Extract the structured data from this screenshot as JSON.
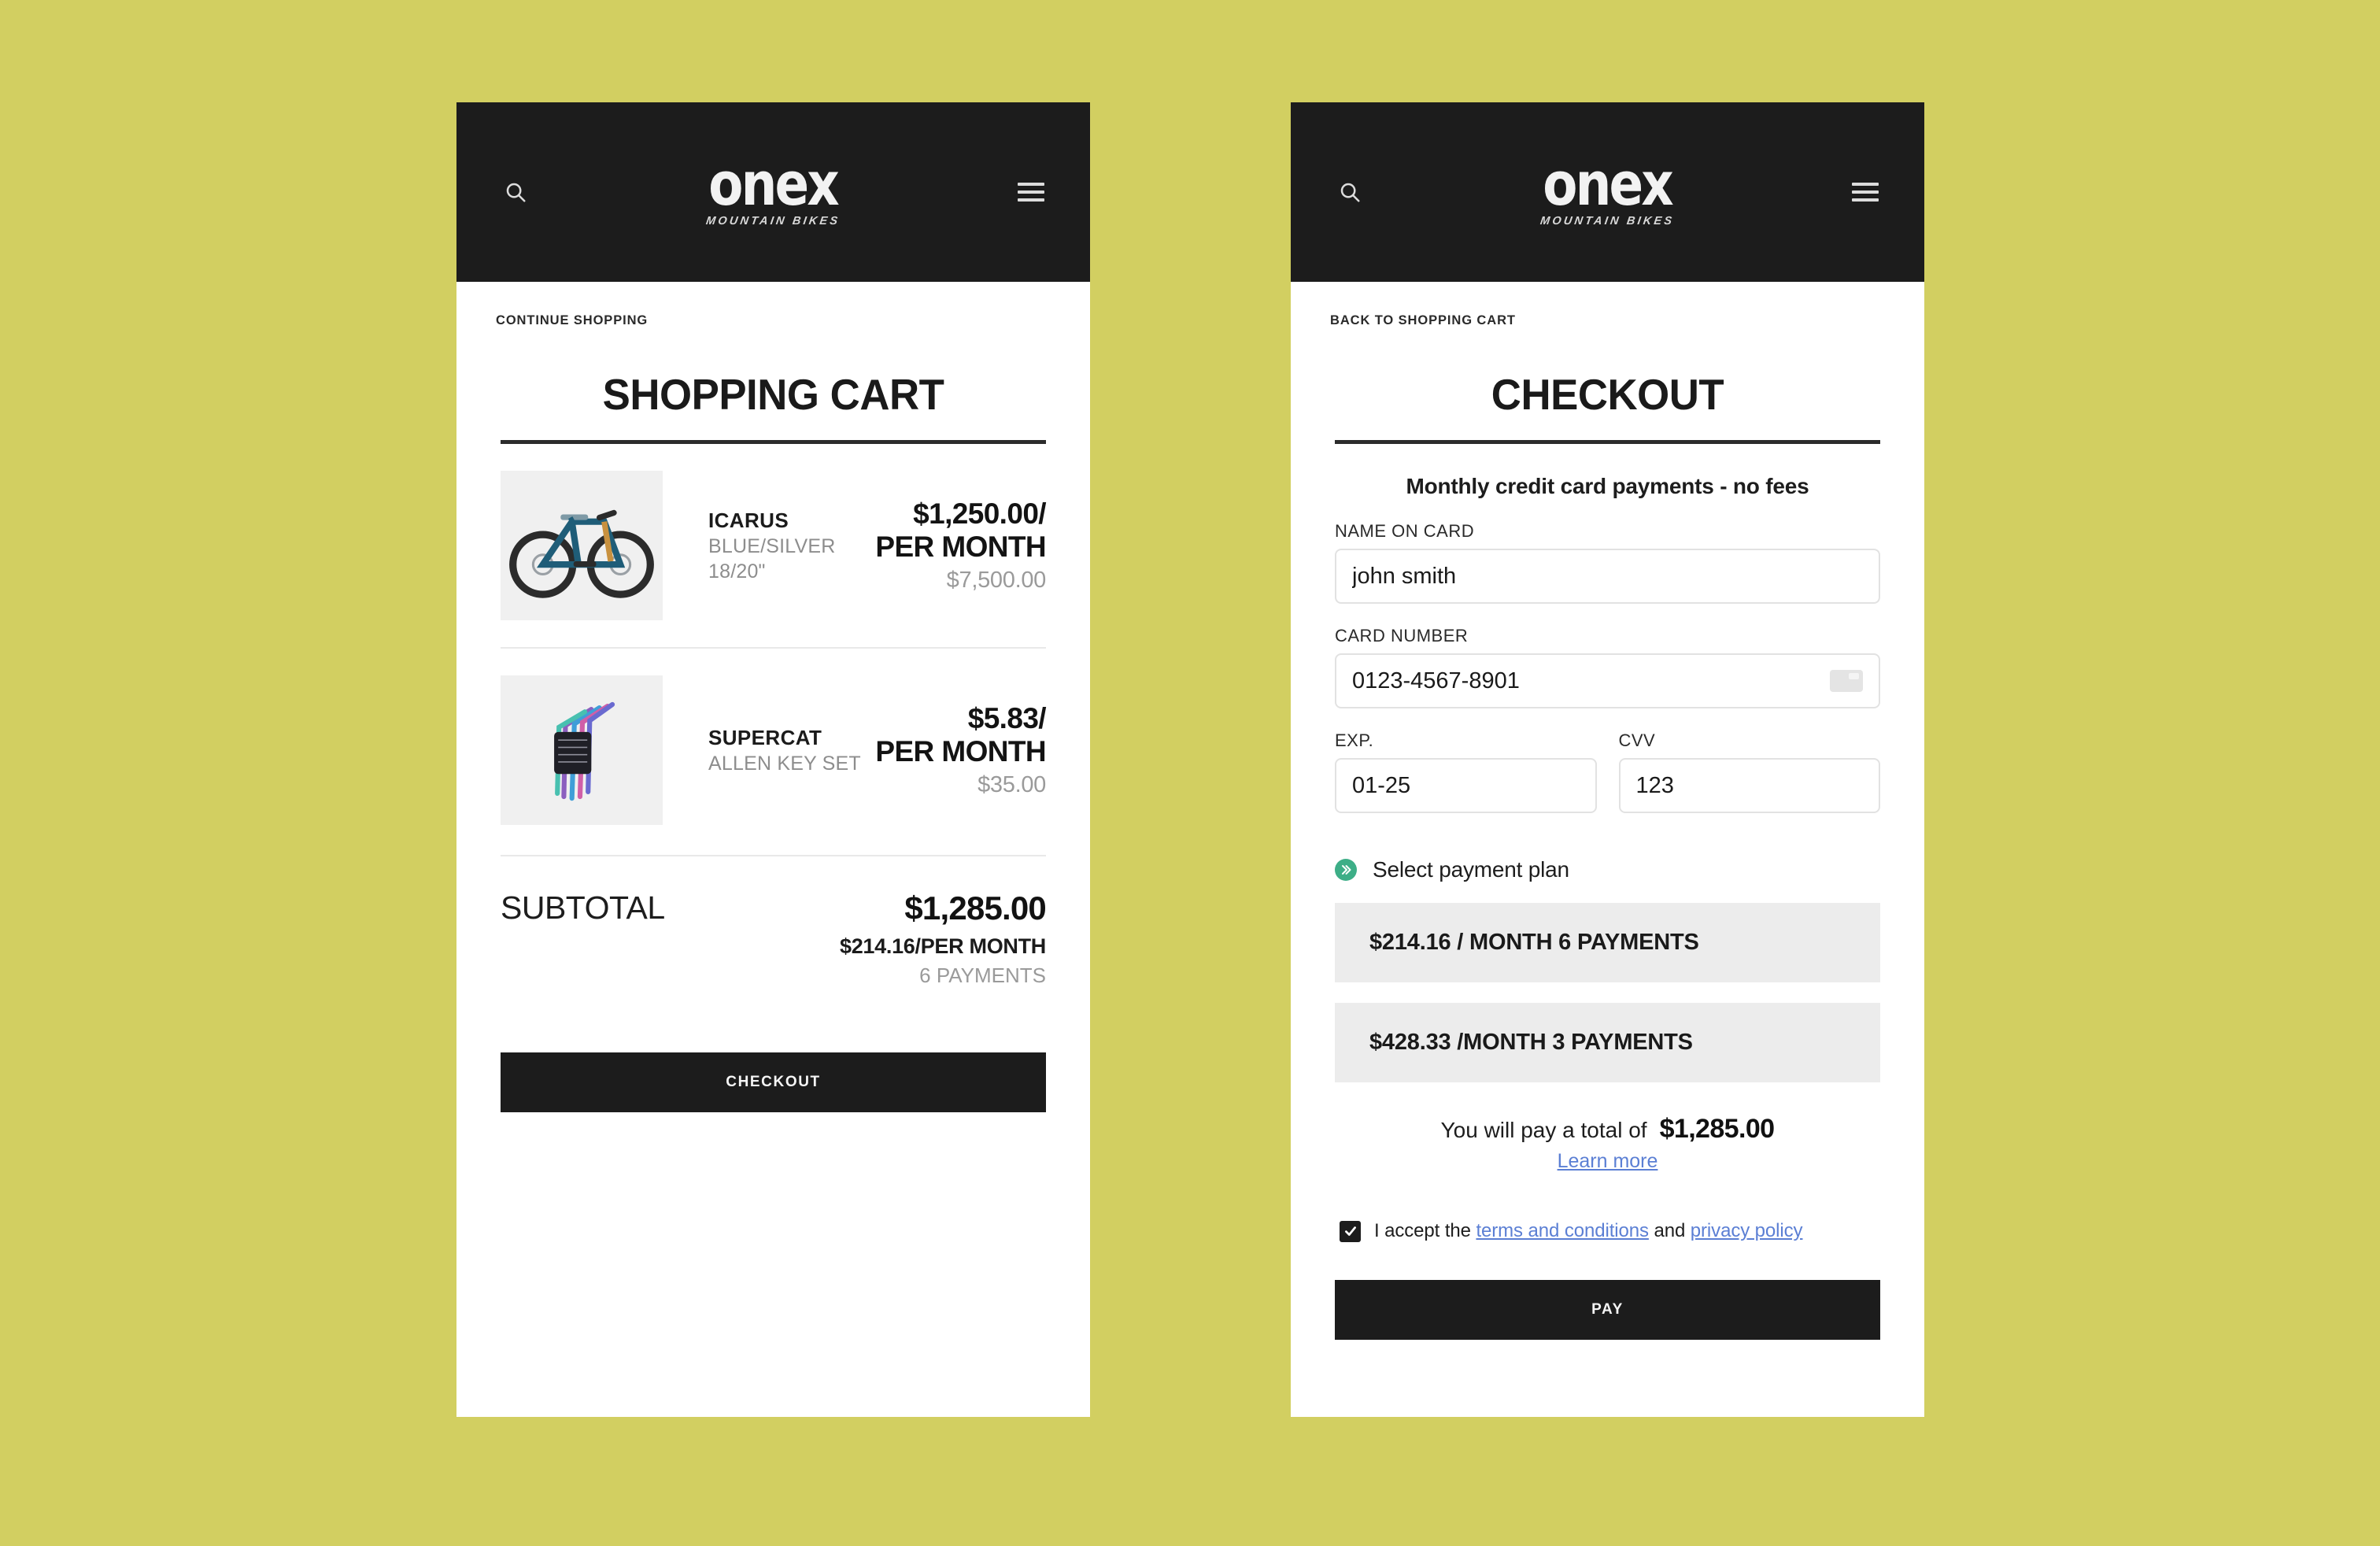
{
  "theme": {
    "page_background": "#d2cf61",
    "header_background": "#1c1c1c",
    "accent_link": "#5b7fd4",
    "plan_chevron_green": "#3dae87",
    "plan_option_background": "#ececec"
  },
  "brand": {
    "name": "onex",
    "tagline": "MOUNTAIN BIKES"
  },
  "cart_screen": {
    "back_link": "CONTINUE SHOPPING",
    "title": "SHOPPING CART",
    "items": [
      {
        "name": "ICARUS",
        "variant": "BLUE/SILVER",
        "size": "18/20\"",
        "price_monthly": "$1,250.00/",
        "price_period": "PER MONTH",
        "price_full": "$7,500.00",
        "image": "mountain-bike"
      },
      {
        "name": "SUPERCAT",
        "variant": "ALLEN KEY SET",
        "size": "",
        "price_monthly": "$5.83/",
        "price_period": "PER MONTH",
        "price_full": "$35.00",
        "image": "allen-key-set"
      }
    ],
    "subtotal": {
      "label": "SUBTOTAL",
      "amount": "$1,285.00",
      "monthly": "$214.16/PER MONTH",
      "payments": "6 PAYMENTS"
    },
    "checkout_button": "CHECKOUT"
  },
  "checkout_screen": {
    "back_link": "BACK TO SHOPPING CART",
    "title": "CHECKOUT",
    "subtitle": "Monthly credit card payments - no fees",
    "fields": {
      "name_on_card": {
        "label": "NAME ON CARD",
        "value": "john smith"
      },
      "card_number": {
        "label": "CARD NUMBER",
        "value": "0123-4567-8901"
      },
      "expiry": {
        "label": "EXP.",
        "value": "01-25"
      },
      "cvv": {
        "label": "CVV",
        "value": "123"
      }
    },
    "plan_section_label": "Select payment plan",
    "plans": [
      {
        "label": "$214.16 / MONTH 6 PAYMENTS"
      },
      {
        "label": "$428.33 /MONTH 3 PAYMENTS"
      }
    ],
    "total": {
      "label": "You will pay a total of",
      "amount": "$1,285.00",
      "learn_more": "Learn more"
    },
    "terms": {
      "prefix": "I accept the ",
      "terms_link": "terms and conditions",
      "conjunction": " and ",
      "privacy_link": "privacy policy",
      "checked": true
    },
    "pay_button": "PAY"
  }
}
